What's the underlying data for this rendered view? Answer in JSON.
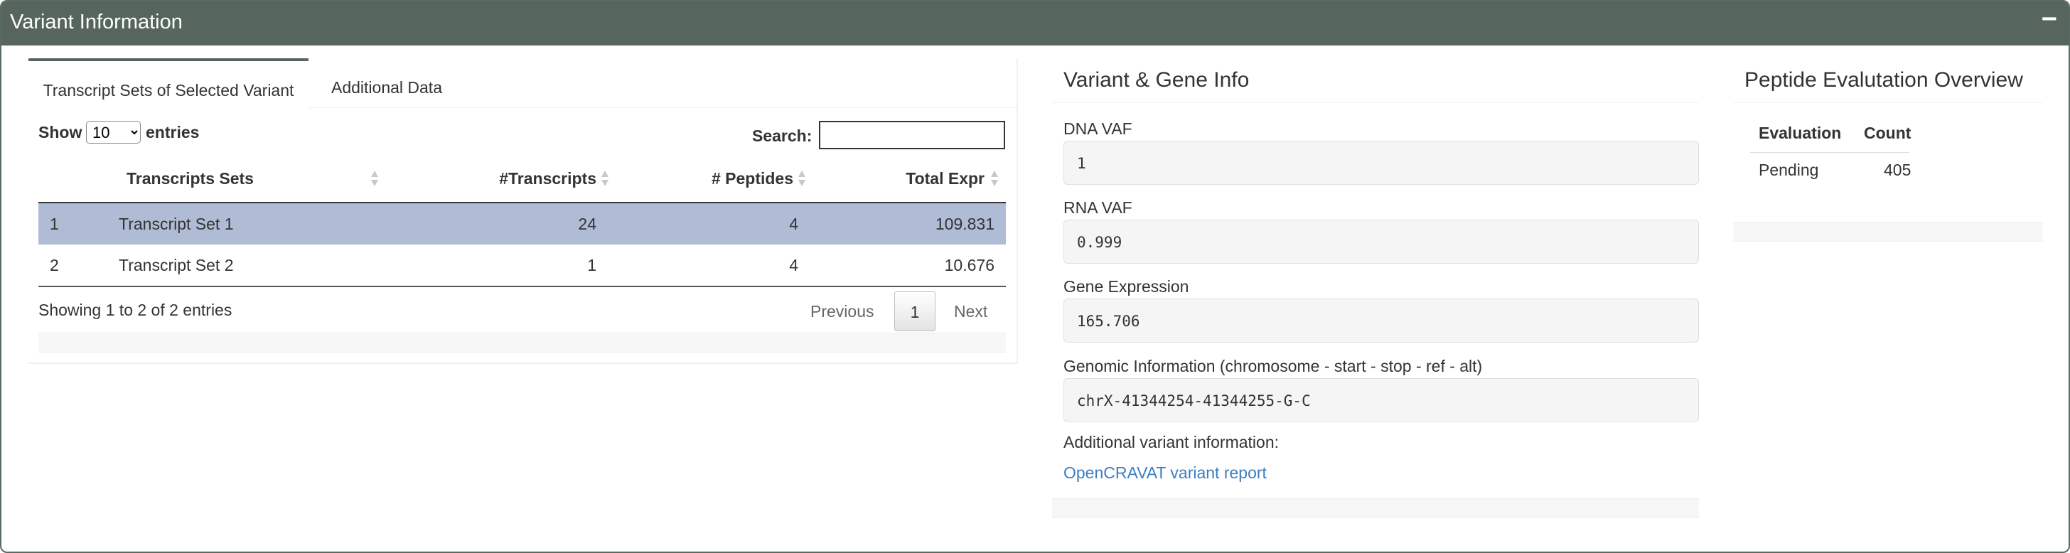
{
  "panel": {
    "title": "Variant Information",
    "collapse_label": "−"
  },
  "tabs": [
    {
      "label": "Transcript Sets of Selected Variant",
      "active": true
    },
    {
      "label": "Additional Data",
      "active": false
    }
  ],
  "datatable": {
    "show_label": "Show",
    "page_length": "10",
    "page_length_options": [
      "10"
    ],
    "entries_label": "entries",
    "search_label": "Search:",
    "search_value": "",
    "columns": [
      "Transcripts Sets",
      "#Transcripts",
      "# Peptides",
      "Total Expr"
    ],
    "rows": [
      {
        "index": "1",
        "name": "Transcript Set 1",
        "transcripts": "24",
        "peptides": "4",
        "total_expr": "109.831",
        "selected": true
      },
      {
        "index": "2",
        "name": "Transcript Set 2",
        "transcripts": "1",
        "peptides": "4",
        "total_expr": "10.676",
        "selected": false
      }
    ],
    "info": "Showing 1 to 2 of 2 entries",
    "pagination": {
      "previous": "Previous",
      "current": "1",
      "next": "Next"
    }
  },
  "variant_gene": {
    "title": "Variant & Gene Info",
    "fields": [
      {
        "label": "DNA VAF",
        "value": "1"
      },
      {
        "label": "RNA VAF",
        "value": "0.999"
      },
      {
        "label": "Gene Expression",
        "value": "165.706"
      },
      {
        "label": "Genomic Information (chromosome - start - stop - ref - alt)",
        "value": "chrX-41344254-41344255-G-C"
      }
    ],
    "additional_label": "Additional variant information:",
    "link_text": "OpenCRAVAT variant report"
  },
  "peptide_overview": {
    "title": "Peptide Evalutation Overview",
    "columns": [
      "Evaluation",
      "Count"
    ],
    "rows": [
      {
        "evaluation": "Pending",
        "count": "405"
      }
    ]
  },
  "colors": {
    "header_bg": "#56665d",
    "selected_row": "#b0bcd6",
    "link": "#3c7fc2"
  }
}
